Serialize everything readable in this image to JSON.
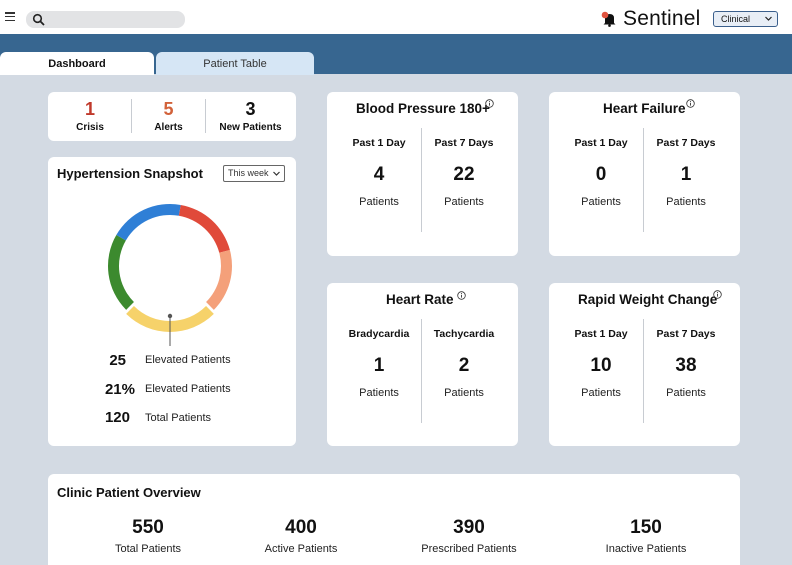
{
  "header": {
    "brand": "Sentinel",
    "clinic_select": "Clinical"
  },
  "tabs": [
    {
      "label": "Dashboard",
      "active": true
    },
    {
      "label": "Patient Table",
      "active": false
    }
  ],
  "summary": [
    {
      "value": "1",
      "label": "Crisis",
      "color": "#c0392b"
    },
    {
      "value": "5",
      "label": "Alerts",
      "color": "#d2623a"
    },
    {
      "value": "3",
      "label": "New Patients",
      "color": "#111111"
    }
  ],
  "snapshot": {
    "title": "Hypertension Snapshot",
    "period": "This week",
    "stats": [
      {
        "value": "25",
        "label": "Elevated Patients"
      },
      {
        "value": "21%",
        "label": "Elevated Patients"
      },
      {
        "value": "120",
        "label": "Total Patients"
      }
    ],
    "donut_colors": [
      "#2f7fd6",
      "#e04a3a",
      "#f4a07a",
      "#f6d26a",
      "#3c8a2e"
    ]
  },
  "bp": {
    "title": "Blood Pressure 180+",
    "cols": [
      {
        "head": "Past 1 Day",
        "value": "4",
        "sub": "Patients"
      },
      {
        "head": "Past 7 Days",
        "value": "22",
        "sub": "Patients"
      }
    ]
  },
  "hf": {
    "title": "Heart Failure",
    "cols": [
      {
        "head": "Past 1 Day",
        "value": "0",
        "sub": "Patients"
      },
      {
        "head": "Past 7 Days",
        "value": "1",
        "sub": "Patients"
      }
    ]
  },
  "hr": {
    "title": "Heart Rate",
    "cols": [
      {
        "head": "Bradycardia",
        "value": "1",
        "sub": "Patients"
      },
      {
        "head": "Tachycardia",
        "value": "2",
        "sub": "Patients"
      }
    ]
  },
  "rw": {
    "title": "Rapid Weight Change",
    "cols": [
      {
        "head": "Past 1 Day",
        "value": "10",
        "sub": "Patients"
      },
      {
        "head": "Past 7 Days",
        "value": "38",
        "sub": "Patients"
      }
    ]
  },
  "overview": {
    "title": "Clinic Patient Overview",
    "items": [
      {
        "value": "550",
        "label": "Total Patients"
      },
      {
        "value": "400",
        "label": "Active Patients"
      },
      {
        "value": "390",
        "label": "Prescribed Patients"
      },
      {
        "value": "150",
        "label": "Inactive Patients"
      }
    ]
  }
}
